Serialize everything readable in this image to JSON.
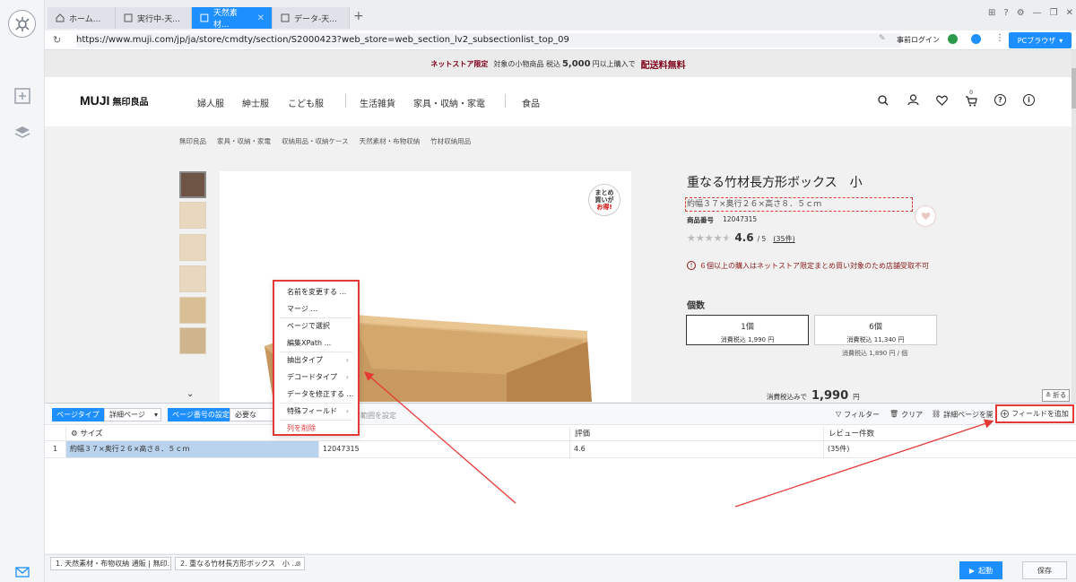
{
  "tabs": [
    {
      "label": "ホーム..."
    },
    {
      "label": "実行中-天..."
    },
    {
      "label": "天然素材..."
    },
    {
      "label": "データ-天..."
    }
  ],
  "address": {
    "url": "https://www.muji.com/jp/ja/store/cmdty/section/S2000423?web_store=web_section_lv2_subsectionlist_top_09",
    "login_label": "事前ログイン",
    "browser_button": "PCブラウザ"
  },
  "site": {
    "promo": {
      "prefix": "ネットストア限定",
      "mid": "対象の小物商品 税込",
      "amount": "5,000",
      "suffix": "円以上購入で",
      "highlight": "配送料無料"
    },
    "logo_en": "MUJI",
    "logo_jp": "無印良品",
    "nav": [
      "婦人服",
      "紳士服",
      "こども服",
      "生活雑貨",
      "家具・収納・家電",
      "食品"
    ],
    "cart_count": "0",
    "breadcrumb": [
      "無印良品",
      "家具・収納・家電",
      "収納用品・収納ケース",
      "天然素材・布物収納",
      "竹材収納用品"
    ],
    "badge": [
      "まとめ",
      "買いが",
      "お得!"
    ],
    "product": {
      "title": "重なる竹材長方形ボックス　小",
      "size": "約幅３７×奥行２６×高さ８．５ｃｍ",
      "code_label": "商品番号",
      "code": "12047315",
      "rating": "4.6",
      "rating_max": "/ 5",
      "reviews": "(35件)",
      "rating_fill": 0.92,
      "notice": "６個以上の購入はネットストア限定まとめ買い対象のため店舗受取不可",
      "qty_label": "個数",
      "options": [
        {
          "title": "1個",
          "price": "消費税込 1,990 円"
        },
        {
          "title": "6個",
          "price": "消費税込 11,340 円"
        }
      ],
      "unit_price": "消費税込 1,890 円 / 個",
      "total_label": "消費税込みで",
      "total": "1,990",
      "total_unit": "円"
    },
    "fold_label": "折る"
  },
  "panel": {
    "page_type_label": "ページタイプ",
    "page_type_value": "詳細ページ",
    "page_num_label": "ページ番号の設定",
    "page_num_value": "必要な",
    "range_label": "範囲を設定",
    "filter": "フィルター",
    "clear": "クリア",
    "detail": "詳細ページを開く",
    "add_field": "フィールドを追加",
    "columns": [
      "サイズ",
      "評価",
      "レビュー件数"
    ],
    "row_index": "1",
    "row": [
      "約幅３７×奥行２６×高さ８．５ｃｍ",
      "12047315",
      "4.6",
      "(35件)"
    ]
  },
  "context_menu": [
    {
      "label": "名前を変更する ..."
    },
    {
      "label": "マージ ..."
    },
    {
      "label": "ページで選択"
    },
    {
      "label": "編集XPath ..."
    },
    {
      "label": "抽出タイプ"
    },
    {
      "label": "デコードタイプ"
    },
    {
      "label": "データを修正する ..."
    },
    {
      "label": "特殊フィールド"
    },
    {
      "label": "列を削除"
    }
  ],
  "bottom_tabs": [
    "1. 天然素材・布物収納 通販 | 無印...",
    "2. 重なる竹材長方形ボックス　小 ..."
  ],
  "actions": {
    "run": "起動",
    "save": "保存"
  },
  "colors": {
    "accent": "#1e8fff",
    "highlight_red": "#e53935",
    "muji_red": "#7f0019"
  }
}
